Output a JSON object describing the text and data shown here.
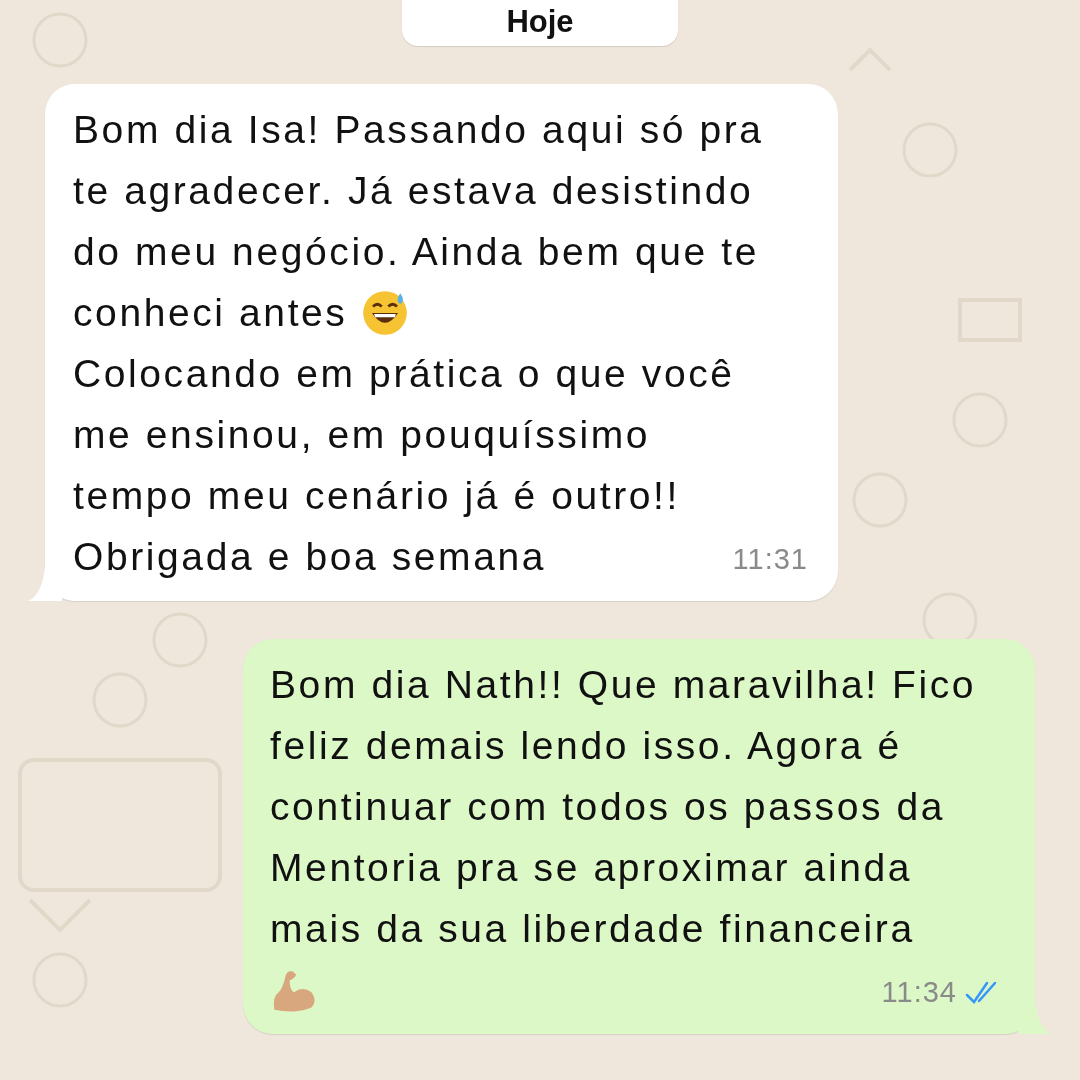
{
  "date_label": "Hoje",
  "messages": [
    {
      "kind": "incoming",
      "lines": [
        {
          "text": "Bom dia Isa! Passando aqui só pra"
        },
        {
          "text": "te agradecer. Já estava desistindo"
        },
        {
          "text": "do meu negócio. Ainda bem que te"
        },
        {
          "kind": "smiling",
          "text": "conheci antes"
        },
        {
          "text": "Colocando em prática o que você"
        },
        {
          "text": "me ensinou, em pouquíssimo"
        },
        {
          "text": "tempo meu cenário já é outro!!"
        },
        {
          "text": "Obrigada e boa semana"
        }
      ],
      "time": "11:31"
    },
    {
      "kind": "outgoing",
      "lines": [
        {
          "text": "Bom dia Nath!! Que maravilha! Fico"
        },
        {
          "text": "feliz demais lendo isso. Agora é"
        },
        {
          "text": "continuar com todos os passos da"
        },
        {
          "text": "Mentoria pra se aproximar ainda"
        },
        {
          "text": "mais da sua liberdade financeira"
        },
        {
          "kind": "biceps"
        }
      ],
      "time": "11:34",
      "read": true
    }
  ]
}
